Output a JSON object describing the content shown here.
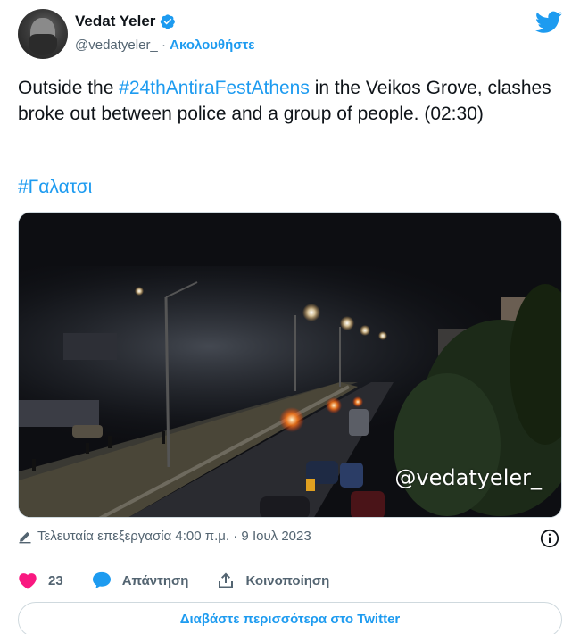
{
  "author": {
    "name": "Vedat Yeler",
    "handle": "@vedatyeler_",
    "separator": "·",
    "follow_label": "Ακολουθήστε",
    "verified_icon": "verified-badge-icon"
  },
  "platform_icon": "twitter-bird-icon",
  "tweet": {
    "text_before": "Outside the ",
    "hashtag": "#24thAntiraFestAthens",
    "text_after": " in the Veikos Grove, clashes broke out between police and a group of people. (02:30)",
    "tag": "#Γαλατσι"
  },
  "media": {
    "watermark": "@vedatyeler_"
  },
  "meta": {
    "edited_icon": "pencil-icon",
    "edited_text": "Τελευταία επεξεργασία 4:00 π.μ. · 9 Ιουλ 2023",
    "info_icon": "info-icon"
  },
  "actions": {
    "like_count": "23",
    "reply_label": "Απάντηση",
    "share_label": "Κοινοποίηση"
  },
  "read_more_label": "Διαβάστε περισσότερα στο Twitter",
  "colors": {
    "accent": "#1d9bf0",
    "like": "#f91880",
    "muted": "#536471"
  }
}
